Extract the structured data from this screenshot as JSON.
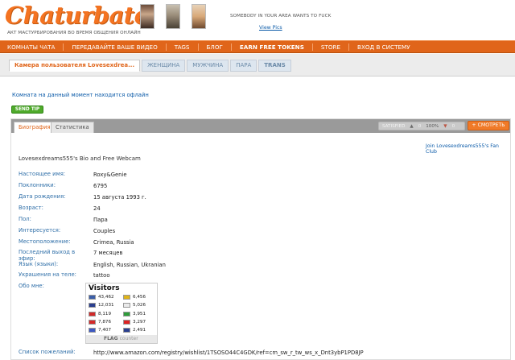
{
  "header": {
    "logo": "Chaturbate",
    "tagline": "АКТ МАСТУРБИРОВАНИЯ ВО ВРЕМЯ ОБЩЕНИЯ ОНЛАЙН",
    "ad_text": "SOMEBODY IN YOUR AREA WANTS TO FUCK",
    "ad_link": "View Pics"
  },
  "nav": {
    "items": [
      "КОМНАТЫ ЧАТА",
      "ПЕРЕДАВАЙТЕ ВАШЕ ВИДЕО",
      "TAGS",
      "БЛОГ",
      "EARN FREE TOKENS",
      "STORE",
      "ВХОД В СИСТЕМУ"
    ]
  },
  "cam_tabs": [
    "Камера пользователя Lovesexdrea...",
    "ЖЕНЩИНА",
    "МУЖЧИНА",
    "ПАРА",
    "TRANS"
  ],
  "room": {
    "offline_message": "Комната на данный момент находится офлайн",
    "send_tip": "SEND TIP"
  },
  "panel": {
    "tabs": [
      "Биография",
      "Статистика"
    ],
    "rating": {
      "label": "SATISFIED",
      "up_count": "0",
      "percent": "100%",
      "down_count": "0"
    },
    "watch_button": "+ СМОТРЕТЬ",
    "fan_club": "Join Lovesexdreams555's Fan Club",
    "bio_title": "Lovesexdreams555's Bio and Free Webcam"
  },
  "bio": {
    "real_name": {
      "label": "Настоящее имя:",
      "value": "Roxy&Genie"
    },
    "followers": {
      "label": "Поклонники:",
      "value": "6795"
    },
    "birth_date": {
      "label": "Дата рождения:",
      "value": "15 августа 1993 г."
    },
    "age": {
      "label": "Возраст:",
      "value": "24"
    },
    "sex": {
      "label": "Пол:",
      "value": "Пара"
    },
    "interested_in": {
      "label": "Интересуется:",
      "value": "Couples"
    },
    "location": {
      "label": "Местоположение:",
      "value": "Crimea, Russia"
    },
    "last_broadcast": {
      "label": "Последний выход в эфир:",
      "value": "7 месяцев"
    },
    "languages": {
      "label": "Язык (языки):",
      "value": "English, Russian, Ukranian"
    },
    "body_decorations": {
      "label": "Украшения на теле:",
      "value": "tattoo"
    },
    "about_me": {
      "label": "Обо мне:"
    },
    "wishlist": {
      "label": "Список пожеланий:",
      "value": "http://www.amazon.com/registry/wishlist/1TSOSO44C4GDK/ref=cm_sw_r_tw_ws_x_Dnt3ybP1PD8JP"
    }
  },
  "flag_counter": {
    "title": "Visitors",
    "footer_brand": "FLAG",
    "footer_word": "counter",
    "left": [
      {
        "value": "43,462",
        "color": "#3c5fa8"
      },
      {
        "value": "12,031",
        "color": "#2a3f8f"
      },
      {
        "value": "8,119",
        "color": "#d12a2a"
      },
      {
        "value": "7,876",
        "color": "#d42a2a"
      },
      {
        "value": "7,407",
        "color": "#3d59c2"
      }
    ],
    "right": [
      {
        "value": "6,456",
        "color": "#e0b418"
      },
      {
        "value": "5,026",
        "color": "#eaeaea"
      },
      {
        "value": "3,951",
        "color": "#2e9c3a"
      },
      {
        "value": "3,297",
        "color": "#d22"
      },
      {
        "value": "2,491",
        "color": "#2a3f8f"
      }
    ]
  }
}
